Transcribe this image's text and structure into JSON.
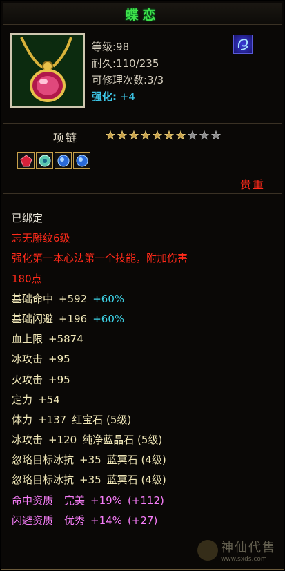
{
  "item": {
    "name": "蝶恋",
    "level": "等级:98",
    "durability": "耐久:110/235",
    "repairs": "可修理次数:3/3",
    "upgrade_label": "强化:",
    "upgrade_value": "+4",
    "type": "项链",
    "stars": {
      "filled": 7,
      "total": 10
    },
    "gems": [
      "red-gem-icon",
      "green-gem-icon",
      "blue-gem-icon",
      "blue-gem-icon"
    ],
    "rarity": "贵重"
  },
  "details": {
    "bound": "已绑定",
    "skill_name": "忘无雕纹6级",
    "skill_desc": "强化第一本心法第一个技能，附加伤害",
    "skill_desc_2": "180点",
    "stats": [
      {
        "label": "基础命中",
        "value": "+592",
        "bonus": "+60%"
      },
      {
        "label": "基础闪避",
        "value": "+196",
        "bonus": "+60%"
      },
      {
        "label": "血上限",
        "value": "+5874"
      },
      {
        "label": "冰攻击",
        "value": "+95"
      },
      {
        "label": "火攻击",
        "value": "+95"
      },
      {
        "label": "定力",
        "value": "+54"
      }
    ],
    "gem_stats": [
      {
        "label": "体力",
        "value": "+137",
        "gem": "红宝石 (5级)"
      },
      {
        "label": "冰攻击",
        "value": "+120",
        "gem": "纯净蓝晶石 (5级)"
      },
      {
        "label": "忽略目标冰抗",
        "value": "+35",
        "gem": "蓝冥石 (4级)"
      },
      {
        "label": "忽略目标冰抗",
        "value": "+35",
        "gem": "蓝冥石 (4级)"
      }
    ],
    "aptitudes": [
      {
        "label": "命中资质",
        "grade": "完美",
        "percent": "+19%",
        "extra": "(+112)"
      },
      {
        "label": "闪避资质",
        "grade": "优秀",
        "percent": "+14%",
        "extra": "(+27)"
      }
    ]
  },
  "watermark": {
    "main": "神仙代售",
    "url": "www.sxds.com"
  },
  "colors": {
    "title": "#3fe04a",
    "red": "#ff2a1a",
    "cyan": "#3ed4e8",
    "pink": "#f57cf7",
    "cream": "#f1e8b8"
  }
}
